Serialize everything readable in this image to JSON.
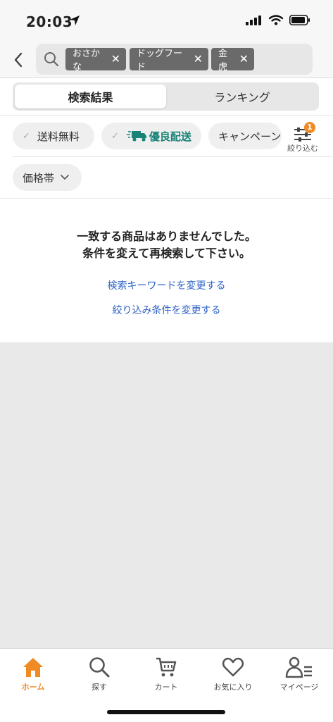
{
  "status_bar": {
    "time": "20:03"
  },
  "search": {
    "chips": [
      {
        "label": "おさかな"
      },
      {
        "label": "ドッグフード"
      },
      {
        "label": "金虎"
      }
    ],
    "chip_remove_glyph": "✕"
  },
  "tabs": {
    "active": "検索結果",
    "inactive": "ランキング"
  },
  "filters": {
    "free_shipping": "送料無料",
    "fast_delivery": "優良配送",
    "campaign": "キャンペーン",
    "narrow_label": "絞り込む",
    "narrow_badge": "1",
    "price_range": "価格帯"
  },
  "no_result": {
    "line1": "一致する商品はありませんでした。",
    "line2": "条件を変えて再検索して下さい。",
    "link_keyword": "検索キーワードを変更する",
    "link_filter": "絞り込み条件を変更する"
  },
  "tabbar": {
    "items": [
      {
        "label": "ホーム",
        "icon": "home-icon"
      },
      {
        "label": "探す",
        "icon": "search-icon"
      },
      {
        "label": "カート",
        "icon": "cart-icon"
      },
      {
        "label": "お気に入り",
        "icon": "heart-icon"
      },
      {
        "label": "マイページ",
        "icon": "user-icon"
      }
    ]
  },
  "colors": {
    "accent": "#f08a24",
    "link": "#2a5fc6",
    "fast_delivery": "#1a8378"
  }
}
